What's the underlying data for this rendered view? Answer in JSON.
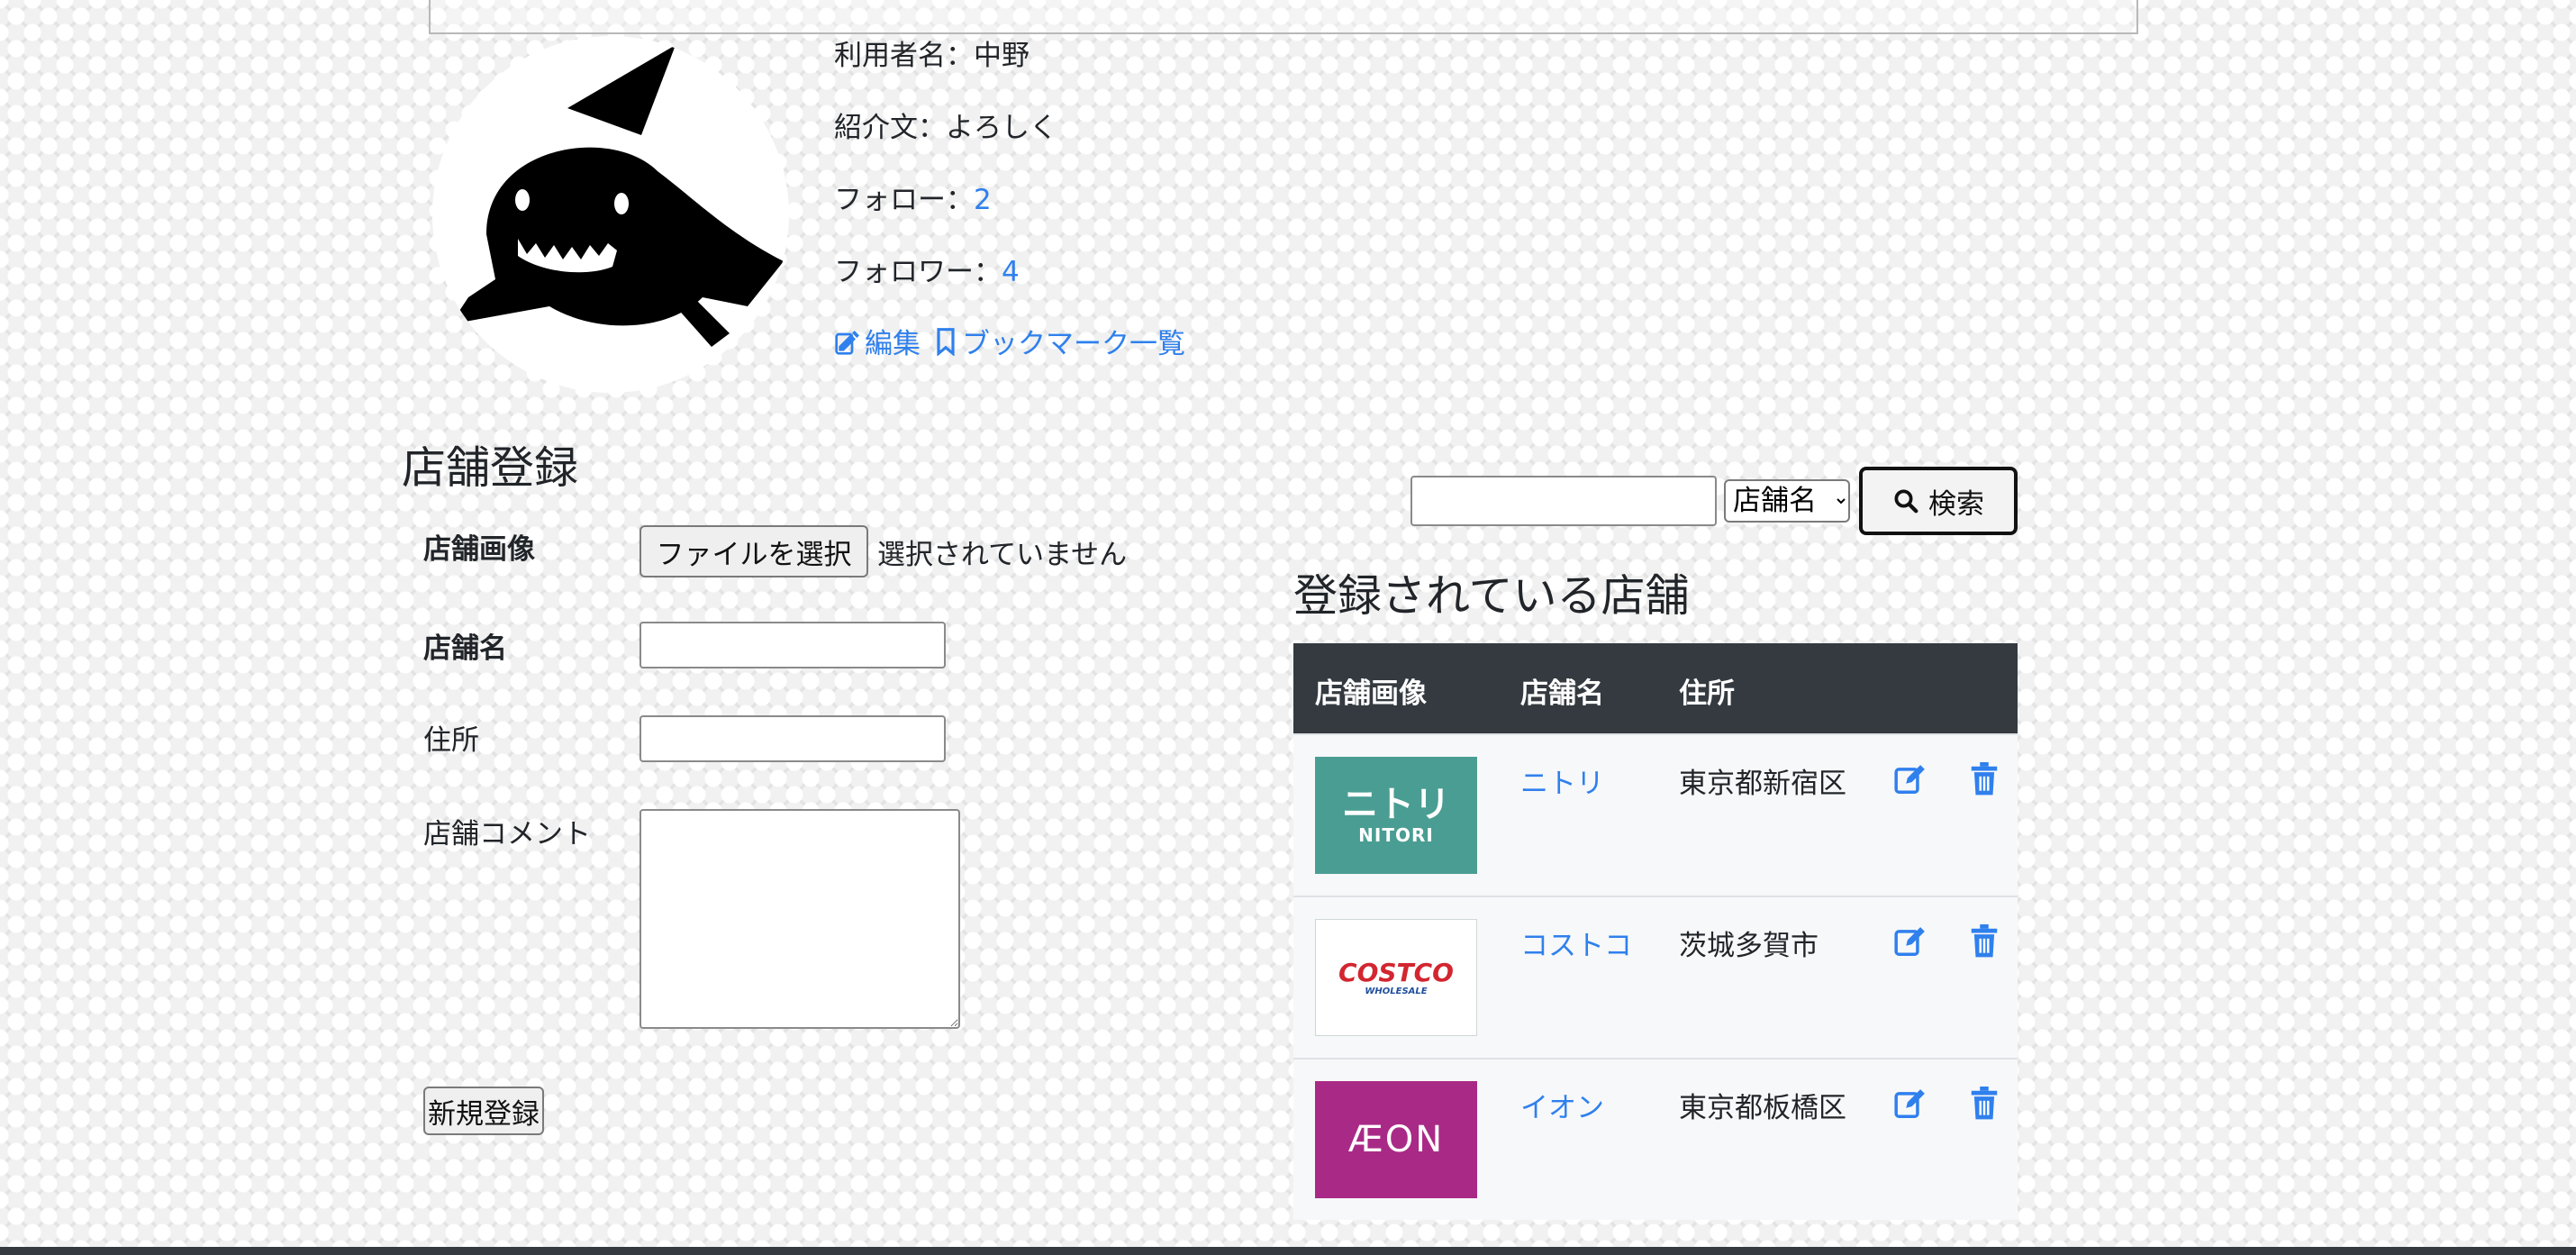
{
  "profile": {
    "username": "利用者名：中野",
    "bio": "紹介文：よろしく",
    "follow_label": "フォロー：",
    "follow_count": "2",
    "follower_label": "フォロワー：",
    "follower_count": "4",
    "edit_link": "編集",
    "bookmark_link": "ブックマーク一覧",
    "avatar_icon": "shark-silhouette"
  },
  "store_form": {
    "title": "店舗登録",
    "image_label": "店舗画像",
    "file_button": "ファイルを選択",
    "file_status": "選択されていません",
    "name_label": "店舗名",
    "address_label": "住所",
    "comment_label": "店舗コメント",
    "submit_label": "新規登録"
  },
  "search": {
    "input_value": "",
    "select_value": "店舗名",
    "button_label": "検索"
  },
  "store_list": {
    "title": "登録されている店舗",
    "columns": [
      "店舗画像",
      "店舗名",
      "住所"
    ],
    "rows": [
      {
        "logo": "NITORI",
        "logo_text": "ニトリ",
        "name": "ニトリ",
        "address": "東京都新宿区",
        "bg": "#4a9d92"
      },
      {
        "logo": "COSTCO",
        "logo_text": "WHOLESALE",
        "name": "コストコ",
        "address": "茨城多賀市",
        "bg": "#ffffff"
      },
      {
        "logo": "ÆON",
        "name": "イオン",
        "address": "東京都板橋区",
        "bg": "#a92a86"
      }
    ]
  },
  "colors": {
    "link": "#2f80ed",
    "table_header": "#343a40"
  }
}
